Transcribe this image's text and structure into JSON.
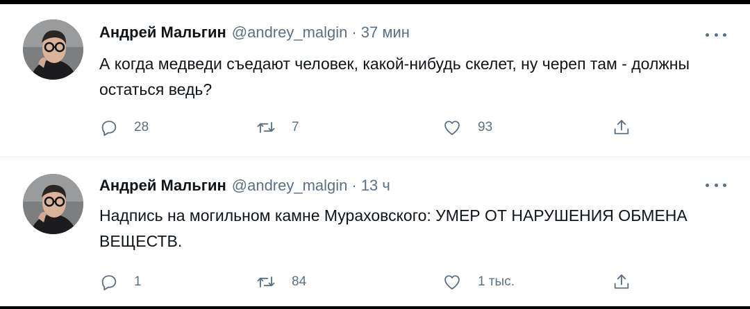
{
  "tweets": [
    {
      "author_name": "Андрей Мальгин",
      "handle": "@andrey_malgin",
      "separator": "·",
      "time": "37 мин",
      "text": "А когда медведи съедают человек, какой-нибудь скелет, ну череп там - должны остаться ведь?",
      "replies": "28",
      "retweets": "7",
      "likes": "93"
    },
    {
      "author_name": "Андрей Мальгин",
      "handle": "@andrey_malgin",
      "separator": "·",
      "time": "13 ч",
      "text": "Надпись на могильном камне Мураховского: УМЕР ОТ НАРУШЕНИЯ ОБМЕНА ВЕЩЕСТВ.",
      "replies": "1",
      "retweets": "84",
      "likes": "1 тыс."
    }
  ],
  "icons": {
    "reply": "comment-icon",
    "retweet": "retweet-icon",
    "like": "heart-icon",
    "share": "share-icon",
    "more": "more-options-icon"
  },
  "colors": {
    "text_primary": "#0f1419",
    "text_secondary": "#5b7083",
    "divider": "#e6ecf0"
  }
}
